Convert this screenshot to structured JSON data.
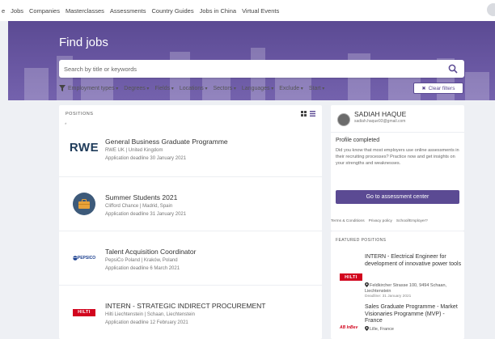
{
  "topnav": {
    "items": [
      "e",
      "Jobs",
      "Companies",
      "Masterclasses",
      "Assessments",
      "Country Guides",
      "Jobs in China",
      "Virtual Events"
    ]
  },
  "hero": {
    "title": "Find jobs"
  },
  "search": {
    "placeholder": "Search by title or keywords",
    "value": ""
  },
  "filters": {
    "items": [
      "Employment types",
      "Degrees",
      "Fields",
      "Locations",
      "Sectors",
      "Languages",
      "Exclude",
      "Start"
    ],
    "clear_label": "Clear filters"
  },
  "positions": {
    "header": "POSITIONS",
    "star": "*",
    "jobs": [
      {
        "title": "General Business Graduate Programme",
        "meta": "RWE UK | United Kingdom",
        "deadline": "Application deadline 30 January 2021",
        "logo_text": "RWE"
      },
      {
        "title": "Summer Students 2021",
        "meta": "Clifford Chance | Madrid, Spain",
        "deadline": "Application deadline 31 January 2021",
        "logo_text": ""
      },
      {
        "title": "Talent Acquisition Coordinator",
        "meta": "PepsiCo Poland | Kraków, Poland",
        "deadline": "Application deadline 6 March 2021",
        "logo_text": "PEPSICO"
      },
      {
        "title": "INTERN - STRATEGIC INDIRECT PROCUREMENT",
        "meta": "Hilti Liechtenstein | Schaan, Liechtenstein",
        "deadline": "Application deadline 12 February 2021",
        "logo_text": "HILTI"
      }
    ]
  },
  "profile": {
    "name": "SADIAH HAQUE",
    "email": "sadiah.haque93@gmail.com",
    "status": "Profile completed",
    "description": "Did you know that most employers use online assessments in their recruiting processes? Practice now and get insights on your strengths and weaknesses.",
    "button_label": "Go to assessment center"
  },
  "footer_links": [
    "Terms & Conditions",
    "Privacy policy",
    "School/Employer?"
  ],
  "featured": {
    "header": "FEATURED POSITIONS",
    "items": [
      {
        "title": "INTERN - Electrical Engineer for development of innovative power tools",
        "location": "Feldkircher Strasse 100, 9494 Schaan, Liechtenstein",
        "deadline": "Deadline: 31 January 2021",
        "logo_text": "HILTI"
      },
      {
        "title": "Sales Graduate Programme - Market Visionaries Programme (MVP) - France",
        "location": "Lille, France",
        "deadline": "",
        "logo_text": "AB InBev"
      }
    ]
  },
  "colors": {
    "brand": "#5b4a93",
    "hilti_red": "#d2051e",
    "background": "#eef0f4"
  }
}
